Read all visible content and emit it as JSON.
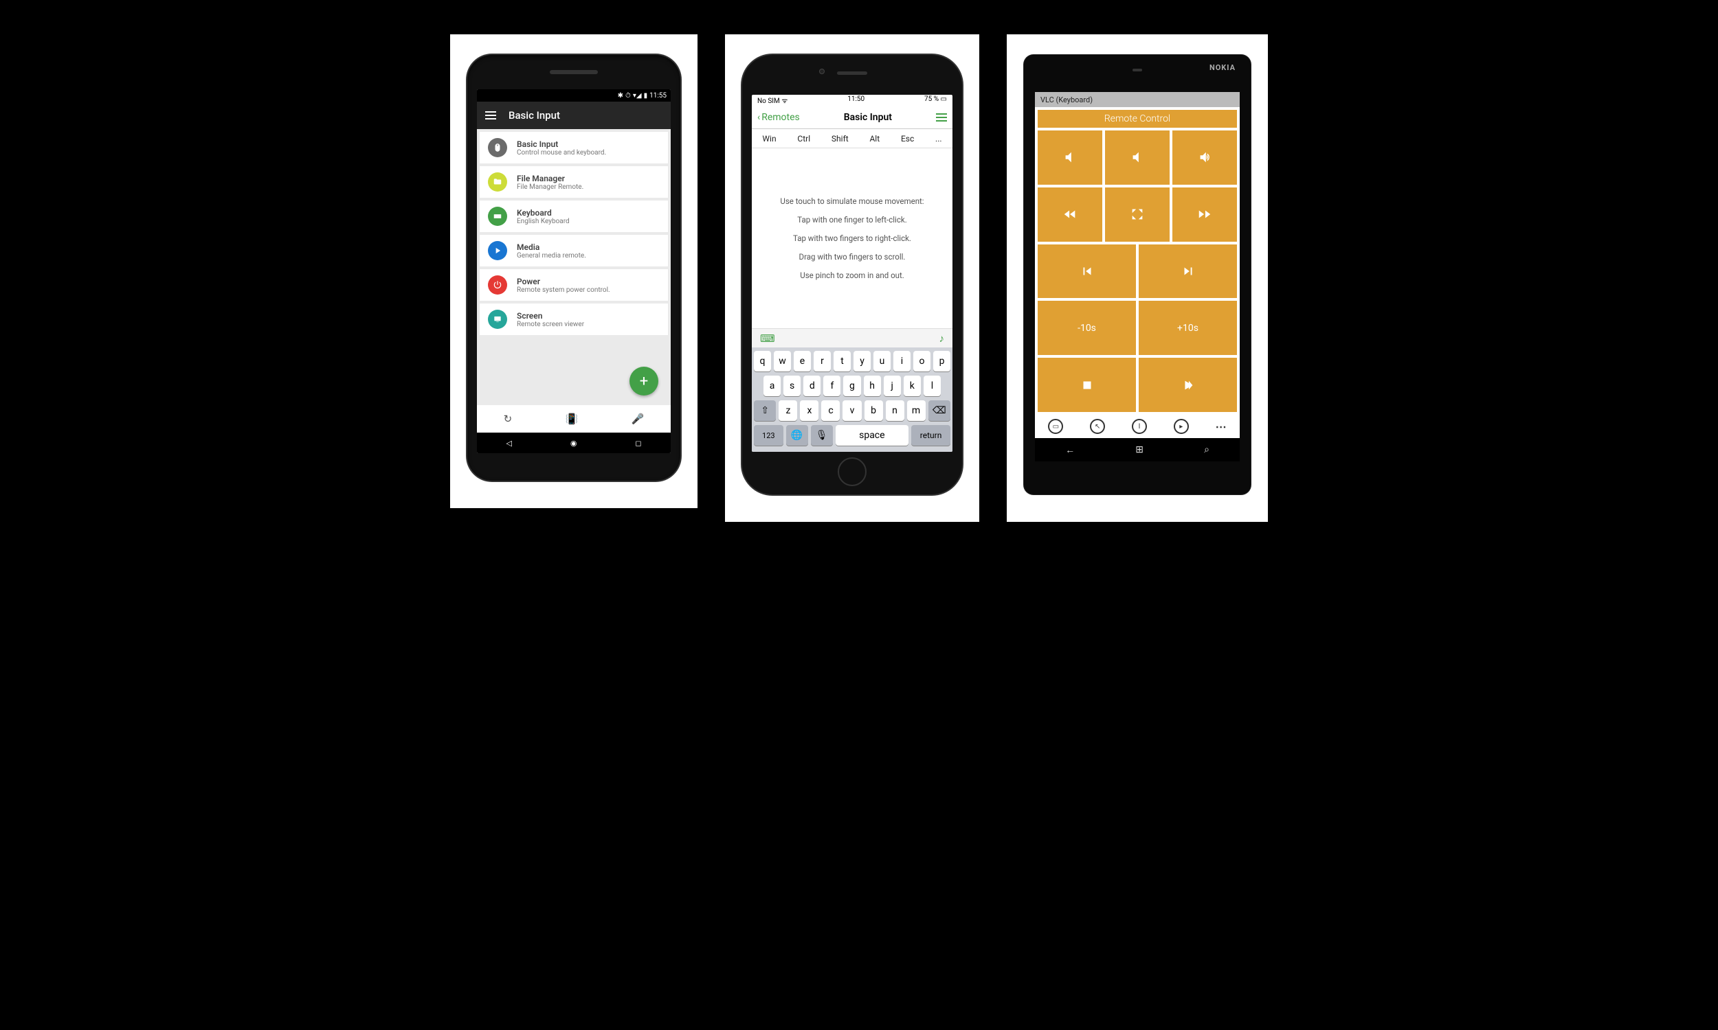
{
  "android": {
    "status_time": "11:55",
    "appbar_title": "Basic Input",
    "items": [
      {
        "icon": "mouse",
        "color": "#6b6b6b",
        "title": "Basic Input",
        "sub": "Control mouse and keyboard."
      },
      {
        "icon": "folder",
        "color": "#cddc39",
        "title": "File Manager",
        "sub": "File Manager Remote."
      },
      {
        "icon": "keyboard",
        "color": "#43a047",
        "title": "Keyboard",
        "sub": "English Keyboard"
      },
      {
        "icon": "play",
        "color": "#1976d2",
        "title": "Media",
        "sub": "General media remote."
      },
      {
        "icon": "power",
        "color": "#e53935",
        "title": "Power",
        "sub": "Remote system power control."
      },
      {
        "icon": "screen",
        "color": "#26a69a",
        "title": "Screen",
        "sub": "Remote screen viewer"
      }
    ],
    "fab": "+"
  },
  "ios": {
    "status_left": "No SIM",
    "status_time": "11:50",
    "status_right": "75 %",
    "back_label": "Remotes",
    "title": "Basic Input",
    "modkeys": [
      "Win",
      "Ctrl",
      "Shift",
      "Alt",
      "Esc",
      "..."
    ],
    "hints": [
      "Use touch to simulate mouse movement:",
      "Tap with one finger to left-click.",
      "Tap with two fingers to right-click.",
      "Drag with two fingers to scroll.",
      "Use pinch to zoom in and out."
    ],
    "kb_rows": [
      [
        "q",
        "w",
        "e",
        "r",
        "t",
        "y",
        "u",
        "i",
        "o",
        "p"
      ],
      [
        "a",
        "s",
        "d",
        "f",
        "g",
        "h",
        "j",
        "k",
        "l"
      ],
      [
        "⇧",
        "z",
        "x",
        "c",
        "v",
        "b",
        "n",
        "m",
        "⌫"
      ]
    ],
    "kb_bottom": {
      "num": "123",
      "globe": "🌐",
      "mic": "🎙",
      "space": "space",
      "ret": "return"
    }
  },
  "windows": {
    "brand": "NOKIA",
    "header": "VLC (Keyboard)",
    "title": "Remote Control",
    "seek_back": "-10s",
    "seek_fwd": "+10s"
  }
}
